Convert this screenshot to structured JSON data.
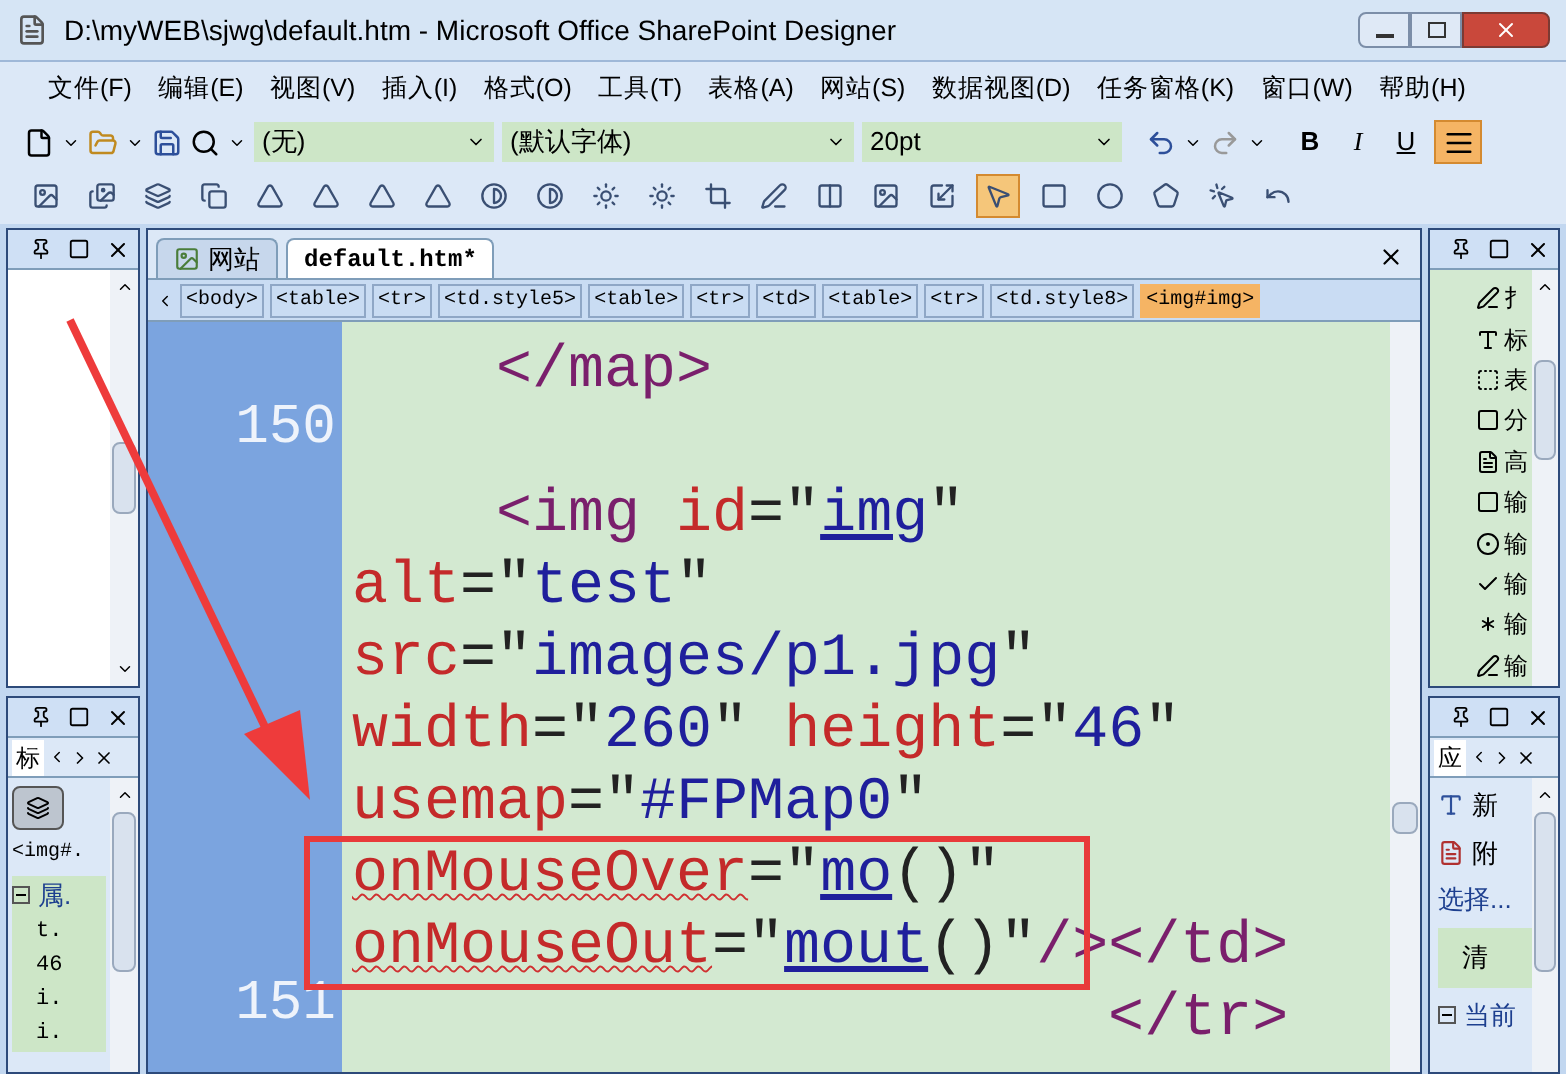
{
  "window": {
    "title": "D:\\myWEB\\sjwg\\default.htm - Microsoft Office SharePoint Designer"
  },
  "menu": [
    "文件(F)",
    "编辑(E)",
    "视图(V)",
    "插入(I)",
    "格式(O)",
    "工具(T)",
    "表格(A)",
    "网站(S)",
    "数据视图(D)",
    "任务窗格(K)",
    "窗口(W)",
    "帮助(H)"
  ],
  "toolbar": {
    "style": "(无)",
    "font": "(默认字体)",
    "size": "20pt",
    "bold": "B",
    "italic": "I",
    "underline": "U",
    "align_selected": true
  },
  "tools": [
    {
      "kind": "picture",
      "selected": false
    },
    {
      "kind": "thumbnail",
      "selected": false
    },
    {
      "kind": "forward",
      "selected": false
    },
    {
      "kind": "backward",
      "selected": false
    },
    {
      "kind": "rotate-left",
      "selected": false
    },
    {
      "kind": "rotate-right",
      "selected": false
    },
    {
      "kind": "flip-h",
      "selected": false
    },
    {
      "kind": "flip-v",
      "selected": false
    },
    {
      "kind": "contrast-up",
      "selected": false
    },
    {
      "kind": "contrast-down",
      "selected": false
    },
    {
      "kind": "bright-up",
      "selected": false
    },
    {
      "kind": "bright-down",
      "selected": false
    },
    {
      "kind": "crop",
      "selected": false
    },
    {
      "kind": "pen",
      "selected": false
    },
    {
      "kind": "columns",
      "selected": false
    },
    {
      "kind": "picture",
      "selected": false
    },
    {
      "kind": "resample",
      "selected": false
    },
    {
      "kind": "pointer",
      "selected": true
    },
    {
      "kind": "rectangle",
      "selected": false
    },
    {
      "kind": "ellipse",
      "selected": false
    },
    {
      "kind": "polygon",
      "selected": false
    },
    {
      "kind": "hotspot",
      "selected": false
    },
    {
      "kind": "restore",
      "selected": false
    }
  ],
  "left_panel": {
    "tab": "标",
    "element": "<img#.",
    "tree": {
      "label": "属.",
      "expanded": true,
      "children": [
        {
          "label": "t."
        },
        {
          "label": "46"
        },
        {
          "label": "i."
        },
        {
          "label": "i."
        }
      ]
    }
  },
  "tabs": [
    {
      "label": "网站",
      "selected": false
    },
    {
      "label": "default.htm*",
      "selected": true
    }
  ],
  "breadcrumb": [
    {
      "label": "<body>",
      "selected": false
    },
    {
      "label": "<table>",
      "selected": false
    },
    {
      "label": "<tr>",
      "selected": false
    },
    {
      "label": "<td.style5>",
      "selected": false
    },
    {
      "label": "<table>",
      "selected": false
    },
    {
      "label": "<tr>",
      "selected": false
    },
    {
      "label": "<td>",
      "selected": false
    },
    {
      "label": "<table>",
      "selected": false
    },
    {
      "label": "<tr>",
      "selected": false
    },
    {
      "label": "<td.style8>",
      "selected": false
    },
    {
      "label": "<img#img>",
      "selected": true
    }
  ],
  "code_lines": [
    {
      "tokens": [
        {
          "kind": "tag",
          "text": "    </map>"
        }
      ]
    },
    {
      "number": "150"
    },
    {
      "tokens": [
        {
          "kind": "tag",
          "text": "    <img "
        },
        {
          "kind": "attr",
          "text": "id"
        },
        {
          "kind": "punct",
          "text": "=\""
        },
        {
          "kind": "value",
          "text": "img",
          "underlined": true
        },
        {
          "kind": "punct",
          "text": "\""
        }
      ]
    },
    {
      "tokens": [
        {
          "kind": "attr",
          "text": "alt"
        },
        {
          "kind": "punct",
          "text": "=\""
        },
        {
          "kind": "value",
          "text": "test"
        },
        {
          "kind": "punct",
          "text": "\""
        }
      ]
    },
    {
      "tokens": [
        {
          "kind": "attr",
          "text": "src"
        },
        {
          "kind": "punct",
          "text": "=\""
        },
        {
          "kind": "value",
          "text": "images/p1.jpg"
        },
        {
          "kind": "punct",
          "text": "\""
        }
      ]
    },
    {
      "tokens": [
        {
          "kind": "attr",
          "text": "width"
        },
        {
          "kind": "punct",
          "text": "=\""
        },
        {
          "kind": "value",
          "text": "260"
        },
        {
          "kind": "punct",
          "text": "\" "
        },
        {
          "kind": "attr",
          "text": "height"
        },
        {
          "kind": "punct",
          "text": "=\""
        },
        {
          "kind": "value",
          "text": "46"
        },
        {
          "kind": "punct",
          "text": "\""
        }
      ]
    },
    {
      "tokens": [
        {
          "kind": "attr",
          "text": "usemap"
        },
        {
          "kind": "punct",
          "text": "=\""
        },
        {
          "kind": "value",
          "text": "#FPMap0"
        },
        {
          "kind": "punct",
          "text": "\""
        }
      ]
    },
    {
      "tokens": [
        {
          "kind": "attr",
          "text": "onMouseOver",
          "misspelled": true
        },
        {
          "kind": "punct",
          "text": "=\""
        },
        {
          "kind": "value",
          "text": "mo",
          "underlined": true
        },
        {
          "kind": "punct",
          "text": "()\""
        }
      ]
    },
    {
      "tokens": [
        {
          "kind": "attr",
          "text": "onMouseOut",
          "misspelled": true
        },
        {
          "kind": "punct",
          "text": "=\""
        },
        {
          "kind": "value",
          "text": "mout",
          "underlined": true
        },
        {
          "kind": "punct",
          "text": "()\""
        },
        {
          "kind": "tag",
          "text": "/></td>"
        }
      ]
    },
    {
      "number": "151",
      "tokens": [
        {
          "kind": "tag",
          "text": "                     </tr>"
        }
      ]
    }
  ],
  "toolbox": [
    {
      "kind": "pen",
      "label": "扌"
    },
    {
      "kind": "letter",
      "label": "标"
    },
    {
      "kind": "dotted",
      "label": "表"
    },
    {
      "kind": "xyz",
      "label": "分"
    },
    {
      "kind": "abc",
      "label": "高"
    },
    {
      "kind": "ab",
      "label": "输"
    },
    {
      "kind": "radio",
      "label": "输"
    },
    {
      "kind": "check",
      "label": "输"
    },
    {
      "kind": "password",
      "label": "输"
    },
    {
      "kind": "pen",
      "label": "输"
    }
  ],
  "right_panel": {
    "tab": "应",
    "new": "新",
    "attach": "附",
    "select": "选择...",
    "header": "清",
    "tree": {
      "label": "当前",
      "expanded": true
    }
  }
}
